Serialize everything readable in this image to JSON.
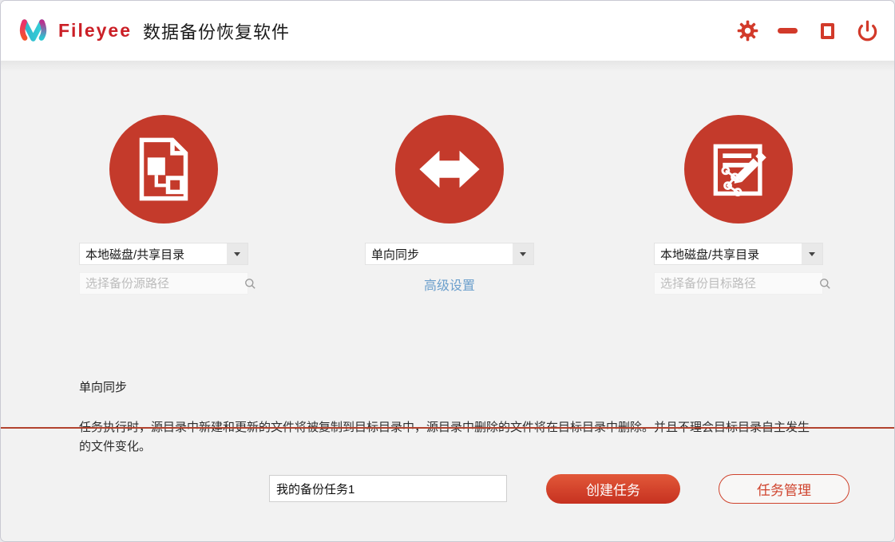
{
  "header": {
    "brand": "Fileyee",
    "app_title": "数据备份恢复软件"
  },
  "source": {
    "type_value": "本地磁盘/共享目录",
    "path_placeholder": "选择备份源路径"
  },
  "sync": {
    "mode_value": "单向同步",
    "advanced_label": "高级设置"
  },
  "target": {
    "type_value": "本地磁盘/共享目录",
    "path_placeholder": "选择备份目标路径"
  },
  "description": {
    "heading": "单向同步",
    "body": "任务执行时，源目录中新建和更新的文件将被复制到目标目录中，源目录中删除的文件将在目标目录中删除。并且不理会目标目录自主发生的文件变化。"
  },
  "footer": {
    "task_name_value": "我的备份任务1",
    "create_label": "创建任务",
    "manage_label": "任务管理"
  },
  "colors": {
    "accent_red": "#c43a2b",
    "titlebar_icon_red": "#d23a2a",
    "divider_red": "#b2432e",
    "link_blue": "#6b9fcc",
    "background": "#f2f2f2"
  }
}
